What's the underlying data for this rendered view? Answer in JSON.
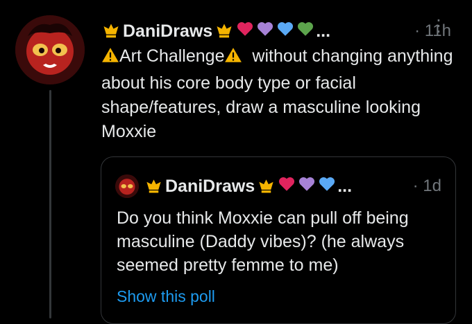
{
  "tweet": {
    "author": "DaniDraws",
    "time": "· 11h",
    "more": "⋮",
    "ellipsis": "...",
    "warn_text": "Art Challenge",
    "body": "without changing anything about his core body type or facial shape/features, draw a masculine looking Moxxie",
    "hearts": [
      "#e0245e",
      "#a682d6",
      "#5aa9f5",
      "#5ca44c"
    ]
  },
  "quote": {
    "author": "DaniDraws",
    "time": "· 1d",
    "ellipsis": "...",
    "body": "Do you think Moxxie can pull off being masculine (Daddy vibes)? (he always seemed pretty femme to me)",
    "link": "Show this poll",
    "hearts": [
      "#e0245e",
      "#a682d6",
      "#5aa9f5"
    ]
  },
  "colors": {
    "background": "#000000",
    "text": "#e7e9ea",
    "muted": "#71767b",
    "link": "#1d9bf0",
    "border": "#333639"
  }
}
